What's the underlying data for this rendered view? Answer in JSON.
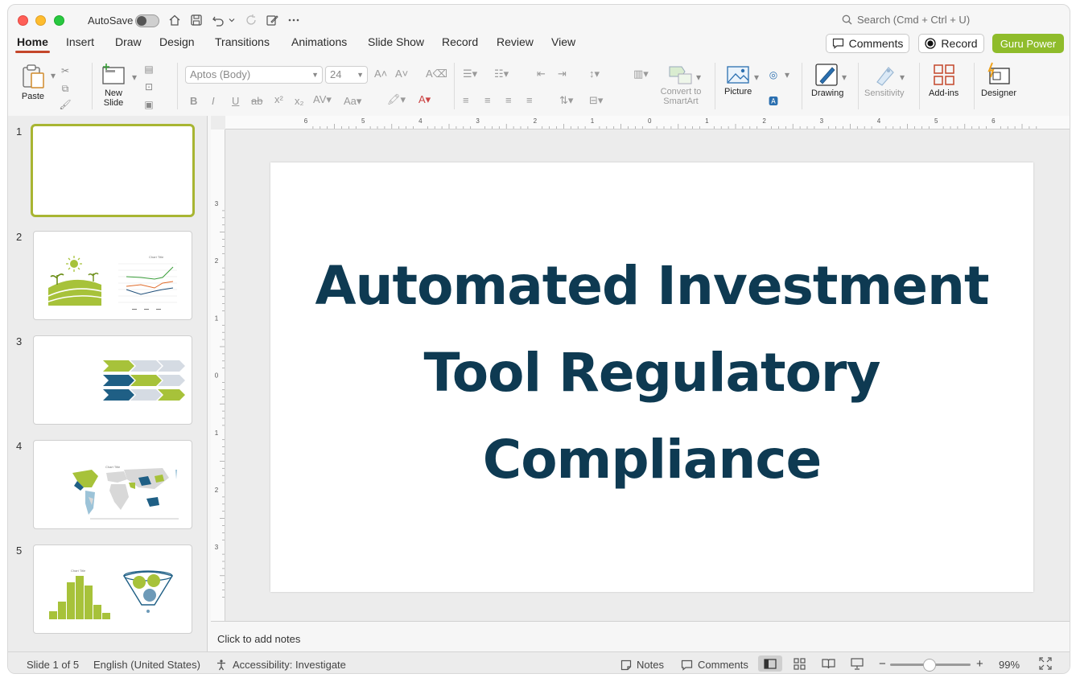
{
  "titlebar": {
    "autosave_label": "AutoSave",
    "search_placeholder": "Search (Cmd + Ctrl + U)"
  },
  "tabs": [
    "Home",
    "Insert",
    "Draw",
    "Design",
    "Transitions",
    "Animations",
    "Slide Show",
    "Record",
    "Review",
    "View"
  ],
  "actions": {
    "comments": "Comments",
    "record": "Record",
    "guru": "Guru Power"
  },
  "ribbon": {
    "paste": "Paste",
    "new_slide": "New Slide",
    "font_name": "Aptos (Body)",
    "font_size": "24",
    "convert_smartart": "Convert to SmartArt",
    "picture": "Picture",
    "drawing": "Drawing",
    "sensitivity": "Sensitivity",
    "addins": "Add-ins",
    "designer": "Designer"
  },
  "ruler": {
    "h_labels": [
      "6",
      "5",
      "4",
      "3",
      "2",
      "1",
      "0",
      "1",
      "2",
      "3",
      "4",
      "5",
      "6"
    ],
    "v_labels": [
      "3",
      "2",
      "1",
      "0",
      "1",
      "2",
      "3"
    ]
  },
  "thumbnails": {
    "numbers": [
      "1",
      "2",
      "3",
      "4",
      "5"
    ],
    "chart_title": "Chart Title"
  },
  "slide": {
    "title_line1": "Automated Investment",
    "title_line2": "Tool Regulatory",
    "title_line3": "Compliance"
  },
  "notes": {
    "placeholder": "Click to add notes"
  },
  "status": {
    "slide_of": "Slide 1 of 5",
    "language": "English (United States)",
    "accessibility": "Accessibility: Investigate",
    "notes": "Notes",
    "comments": "Comments",
    "zoom": "99%",
    "zoom_level_percent": 99
  },
  "colors": {
    "accent_green": "#8fbc2b",
    "title_navy": "#0e3a52",
    "selected_thumb": "#a8b532",
    "tab_underline": "#c4462a"
  }
}
